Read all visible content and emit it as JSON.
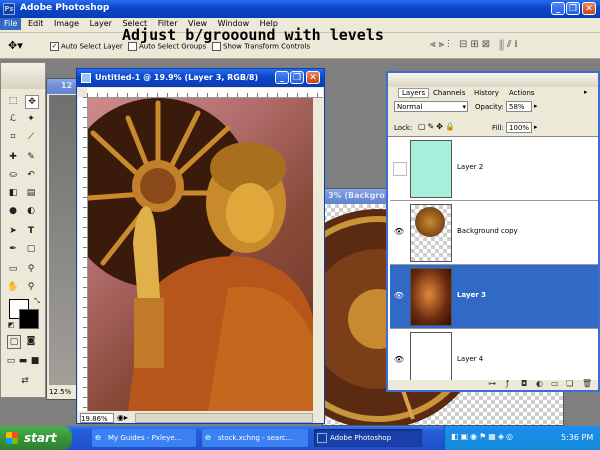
{
  "app": {
    "title": "Adobe Photoshop",
    "menus": [
      "File",
      "Edit",
      "Image",
      "Layer",
      "Select",
      "Filter",
      "View",
      "Window",
      "Help"
    ],
    "overlay_caption": "Adjust b/grooound with levels"
  },
  "options_bar": {
    "auto_select_layer": "Auto Select Layer",
    "auto_select_groups": "Auto Select Groups",
    "show_transform_controls": "Show Transform Controls"
  },
  "doc_back": {
    "title_fragment": "12",
    "zoom": "12.5%"
  },
  "doc_bg": {
    "title": "3% (Backgro"
  },
  "doc_main": {
    "title": "Untitled-1 @ 19.9% (Layer 3, RGB/8)",
    "zoom": "19.86%"
  },
  "layers_panel": {
    "tabs": [
      "Layers",
      "Channels",
      "History",
      "Actions"
    ],
    "blend_mode": "Normal",
    "opacity_label": "Opacity:",
    "opacity_value": "58%",
    "lock_label": "Lock:",
    "fill_label": "Fill:",
    "fill_value": "100%",
    "layers": [
      {
        "name": "Layer 2",
        "visible": false,
        "selected": false
      },
      {
        "name": "Background copy",
        "visible": true,
        "selected": false
      },
      {
        "name": "Layer 3",
        "visible": true,
        "selected": true
      },
      {
        "name": "Layer 4",
        "visible": true,
        "selected": false
      }
    ]
  },
  "taskbar": {
    "start": "start",
    "items": [
      "My Guides - Pxleye...",
      "stock.xchng - searc...",
      "Adobe Photoshop"
    ],
    "time": "5:36 PM"
  },
  "colors": {
    "xp_blue": "#0a46c8",
    "selected_layer": "#3169c6",
    "layer2_fill": "#a8f0dc",
    "taskbar": "#245edb",
    "start_green": "#3c9a3c"
  }
}
